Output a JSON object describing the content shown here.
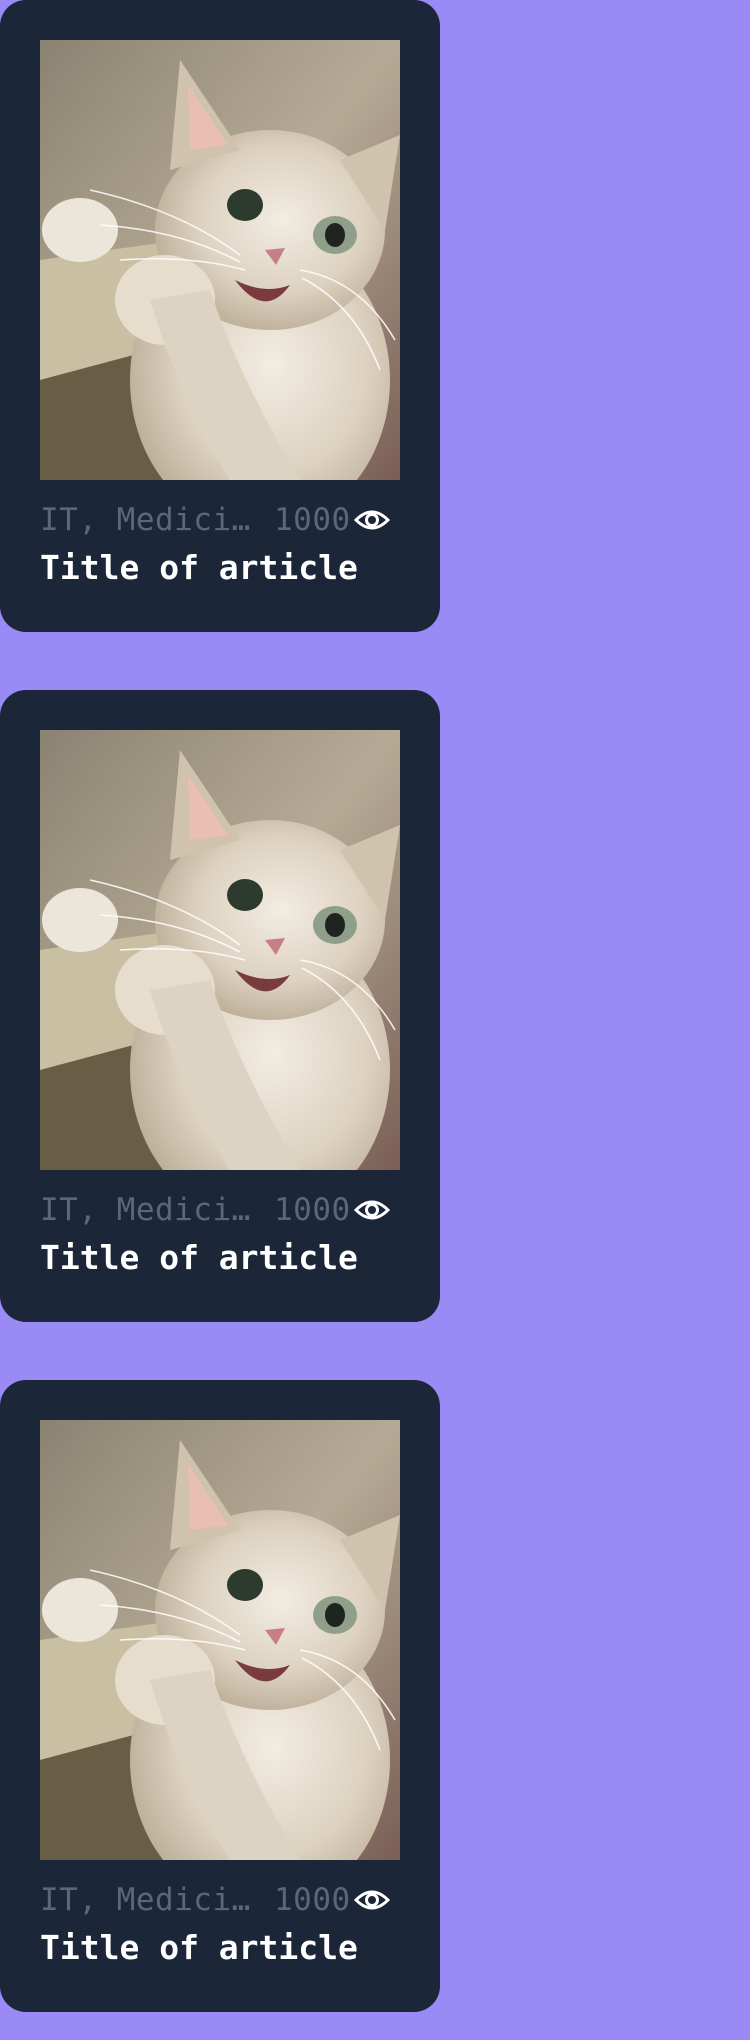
{
  "background_color": "#9a8af5",
  "card_color": "#1b2639",
  "cards": [
    {
      "image": "kitten-photo",
      "tags": "IT, Medicine",
      "views": "1000",
      "views_icon": "eye-icon",
      "title": "Title of article"
    },
    {
      "image": "kitten-photo",
      "tags": "IT, Medicine",
      "views": "1000",
      "views_icon": "eye-icon",
      "title": "Title of article"
    },
    {
      "image": "kitten-photo",
      "tags": "IT, Medicine",
      "views": "1000",
      "views_icon": "eye-icon",
      "title": "Title of article"
    }
  ]
}
